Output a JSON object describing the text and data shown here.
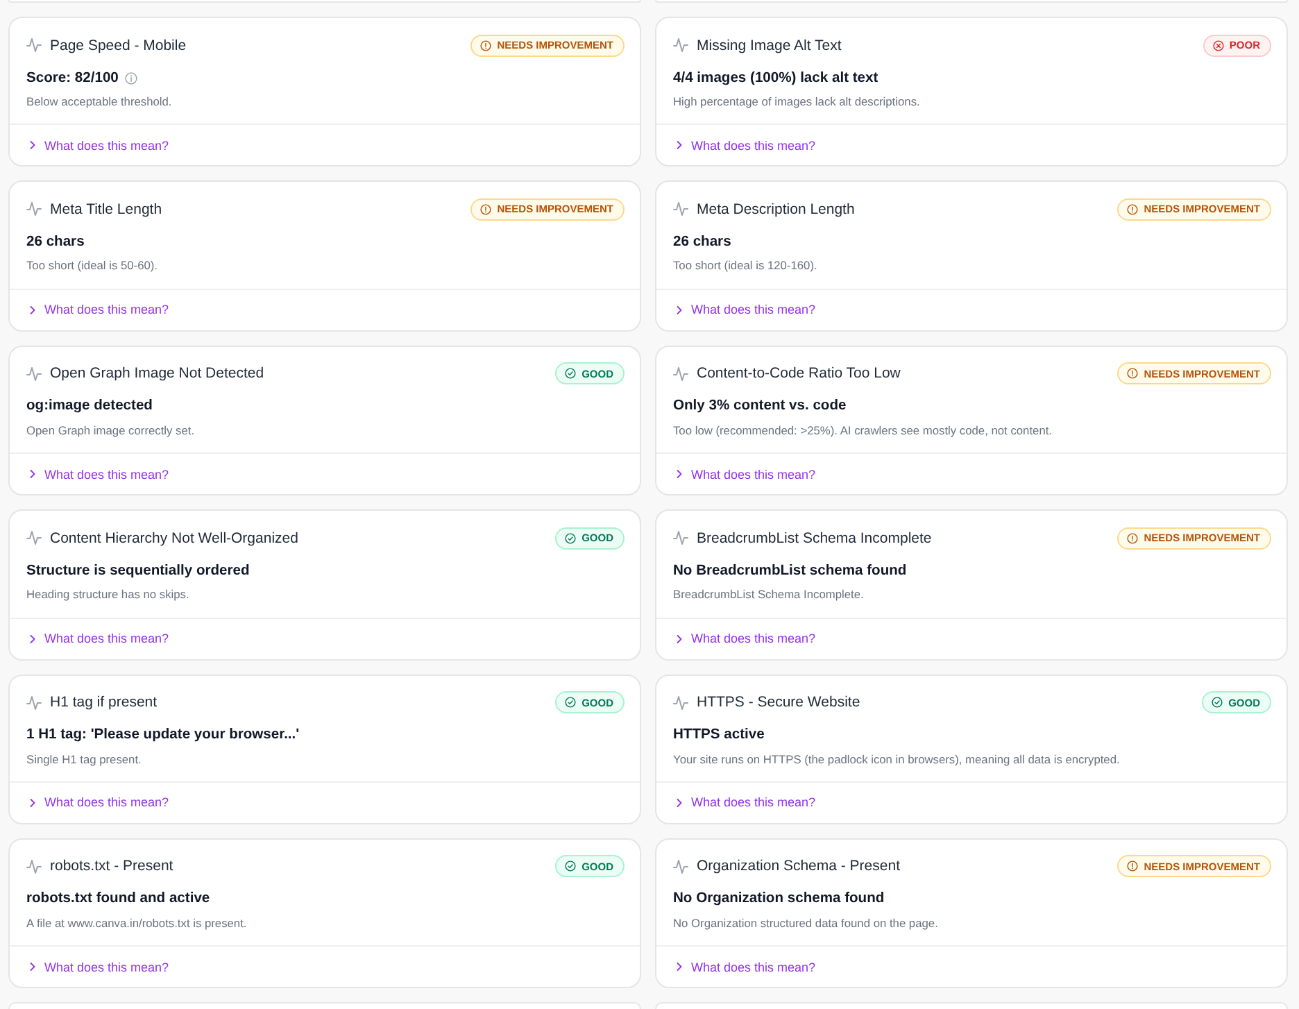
{
  "cards": [
    {
      "title": "Page Speed - Mobile",
      "status": {
        "kind": "warning",
        "label": "NEEDS IMPROVEMENT"
      },
      "value": "Score: 82/100",
      "info_icon": true,
      "description": "Below acceptable threshold.",
      "link": {
        "label": "What does this mean?",
        "expanded": false
      }
    },
    {
      "title": "Missing Image Alt Text",
      "status": {
        "kind": "poor",
        "label": "POOR"
      },
      "value": "4/4 images (100%) lack alt text",
      "info_icon": false,
      "description": "High percentage of images lack alt descriptions.",
      "link": {
        "label": "What does this mean?",
        "expanded": false
      }
    },
    {
      "title": "Meta Title Length",
      "status": {
        "kind": "warning",
        "label": "NEEDS IMPROVEMENT"
      },
      "value": "26 chars",
      "info_icon": false,
      "description": "Too short (ideal is 50-60).",
      "link": {
        "label": "What does this mean?",
        "expanded": false
      }
    },
    {
      "title": "Meta Description Length",
      "status": {
        "kind": "warning",
        "label": "NEEDS IMPROVEMENT"
      },
      "value": "26 chars",
      "info_icon": false,
      "description": "Too short (ideal is 120-160).",
      "link": {
        "label": "What does this mean?",
        "expanded": false
      }
    },
    {
      "title": "Open Graph Image Not Detected",
      "status": {
        "kind": "good",
        "label": "GOOD"
      },
      "value": "og:image detected",
      "info_icon": false,
      "description": "Open Graph image correctly set.",
      "link": {
        "label": "What does this mean?",
        "expanded": false
      }
    },
    {
      "title": "Content-to-Code Ratio Too Low",
      "status": {
        "kind": "warning",
        "label": "NEEDS IMPROVEMENT"
      },
      "value": "Only 3% content vs. code",
      "info_icon": false,
      "description": "Too low (recommended: >25%). AI crawlers see mostly code, not content.",
      "link": {
        "label": "What does this mean?",
        "expanded": false
      }
    },
    {
      "title": "Content Hierarchy Not Well-Organized",
      "status": {
        "kind": "good",
        "label": "GOOD"
      },
      "value": "Structure is sequentially ordered",
      "info_icon": false,
      "description": "Heading structure has no skips.",
      "link": {
        "label": "What does this mean?",
        "expanded": false
      }
    },
    {
      "title": "BreadcrumbList Schema Incomplete",
      "status": {
        "kind": "warning",
        "label": "NEEDS IMPROVEMENT"
      },
      "value": "No BreadcrumbList schema found",
      "info_icon": false,
      "description": "BreadcrumbList Schema Incomplete.",
      "link": {
        "label": "What does this mean?",
        "expanded": false
      }
    },
    {
      "title": "H1 tag if present",
      "status": {
        "kind": "good",
        "label": "GOOD"
      },
      "value": "1 H1 tag: 'Please update your browser...'",
      "info_icon": false,
      "description": "Single H1 tag present.",
      "link": {
        "label": "What does this mean?",
        "expanded": false
      }
    },
    {
      "title": "HTTPS - Secure Website",
      "status": {
        "kind": "good",
        "label": "GOOD"
      },
      "value": "HTTPS active",
      "info_icon": false,
      "description": "Your site runs on HTTPS (the padlock icon in browsers), meaning all data is encrypted.",
      "link": {
        "label": "What does this mean?",
        "expanded": false
      }
    },
    {
      "title": "robots.txt - Present",
      "status": {
        "kind": "good",
        "label": "GOOD"
      },
      "value": "robots.txt found and active",
      "info_icon": false,
      "description": "A file at www.canva.in/robots.txt is present.",
      "link": {
        "label": "What does this mean?",
        "expanded": false
      }
    },
    {
      "title": "Organization Schema - Present",
      "status": {
        "kind": "warning",
        "label": "NEEDS IMPROVEMENT"
      },
      "value": "No Organization schema found",
      "info_icon": false,
      "description": "No Organization structured data found on the page.",
      "link": {
        "label": "What does this mean?",
        "expanded": false
      }
    }
  ]
}
